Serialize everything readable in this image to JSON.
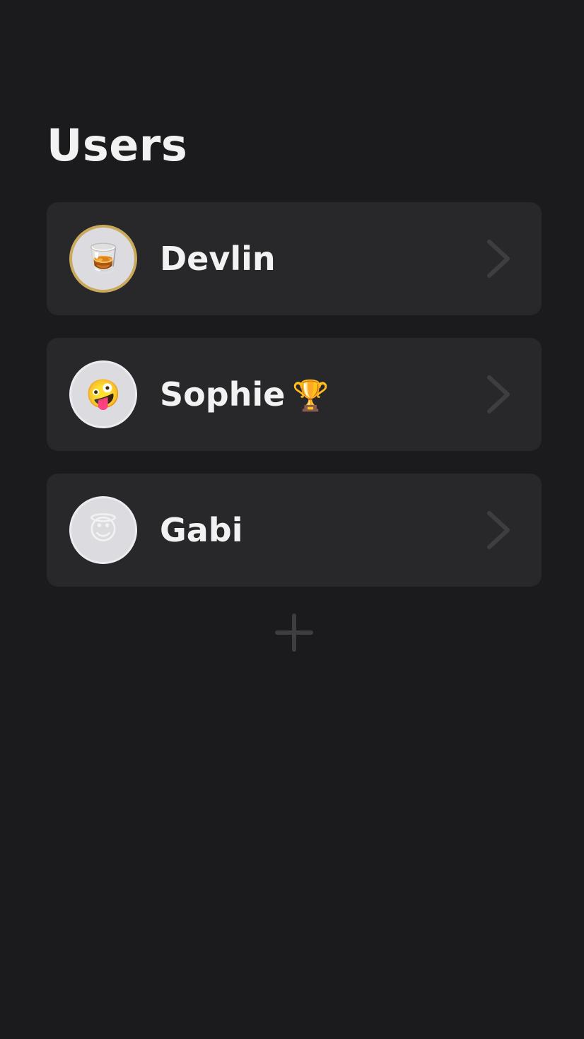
{
  "page": {
    "title": "Users"
  },
  "users": [
    {
      "name": "Devlin",
      "avatar_emoji": "🥃",
      "badge": "",
      "highlighted": true
    },
    {
      "name": "Sophie",
      "avatar_emoji": "🤪",
      "badge": "🏆",
      "highlighted": false
    },
    {
      "name": "Gabi",
      "avatar_emoji": "😇",
      "badge": "",
      "highlighted": false
    }
  ],
  "icons": {
    "row_action": "chevron-right-icon",
    "add": "plus-icon"
  },
  "colors": {
    "background": "#1b1b1d",
    "row_background": "#28282b",
    "text": "#f2f2f2",
    "highlight_ring": "#c9a95c",
    "muted_icon": "#3e3e42"
  }
}
